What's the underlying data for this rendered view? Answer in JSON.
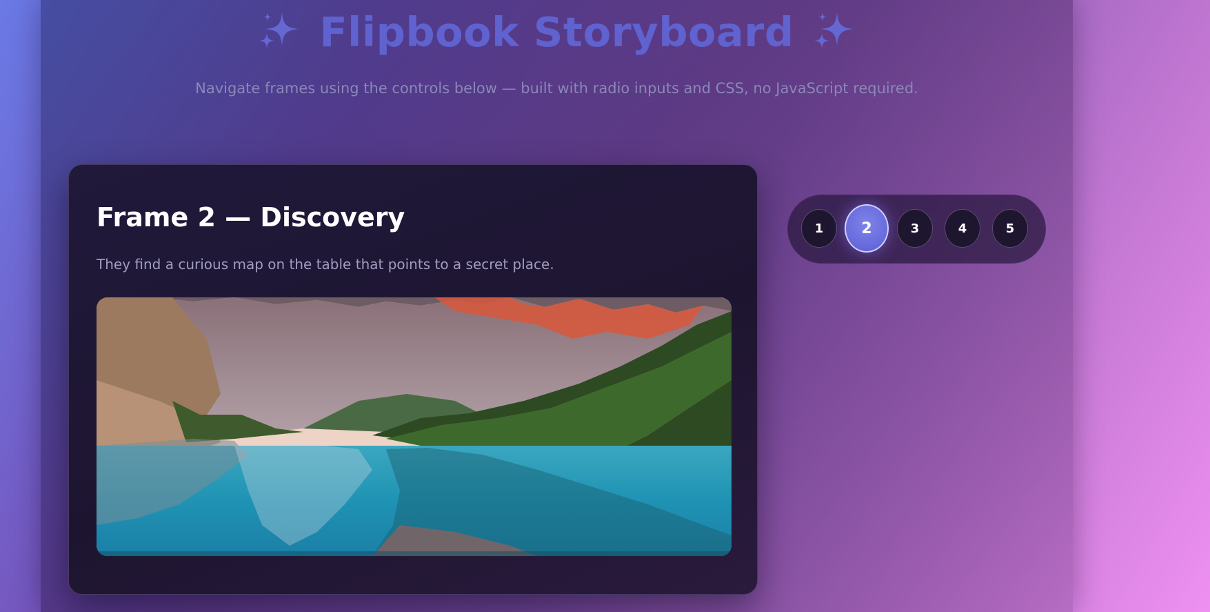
{
  "header": {
    "title": "Flipbook Storyboard",
    "subtitle": "Navigate frames using the controls below — built with radio inputs and CSS, no JavaScript required.",
    "left_icon": "sparkles-icon",
    "right_icon": "sparkles-icon"
  },
  "frame": {
    "title": "Frame 2 — Discovery",
    "description": "They find a curious map on the table that points to a secret place.",
    "image": "mountain-lake-landscape"
  },
  "navigation": {
    "selected": "2",
    "items": [
      {
        "label": "1"
      },
      {
        "label": "2"
      },
      {
        "label": "3"
      },
      {
        "label": "4"
      },
      {
        "label": "5"
      }
    ]
  },
  "colors": {
    "accent": "#6a6ddd",
    "title": "#5f62cf",
    "card_background": "#1d1530"
  }
}
